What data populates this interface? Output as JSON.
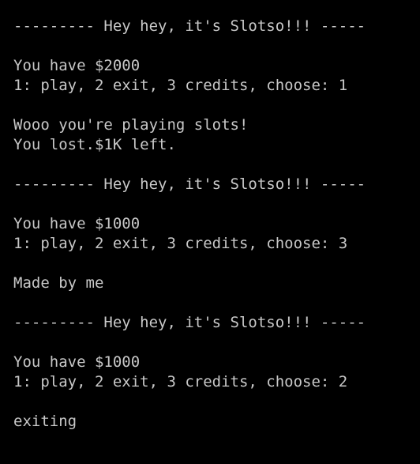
{
  "console": {
    "text_color": "#c8c8c8",
    "background_color": "#000000",
    "lines": [
      "--------- Hey hey, it's Slotso!!! -----",
      "",
      "You have $2000",
      "1: play, 2 exit, 3 credits, choose: 1",
      "",
      "Wooo you're playing slots!",
      "You lost.$1K left.",
      "",
      "--------- Hey hey, it's Slotso!!! -----",
      "",
      "You have $1000",
      "1: play, 2 exit, 3 credits, choose: 3",
      "",
      "Made by me",
      "",
      "--------- Hey hey, it's Slotso!!! -----",
      "",
      "You have $1000",
      "1: play, 2 exit, 3 credits, choose: 2",
      "",
      "exiting"
    ]
  }
}
